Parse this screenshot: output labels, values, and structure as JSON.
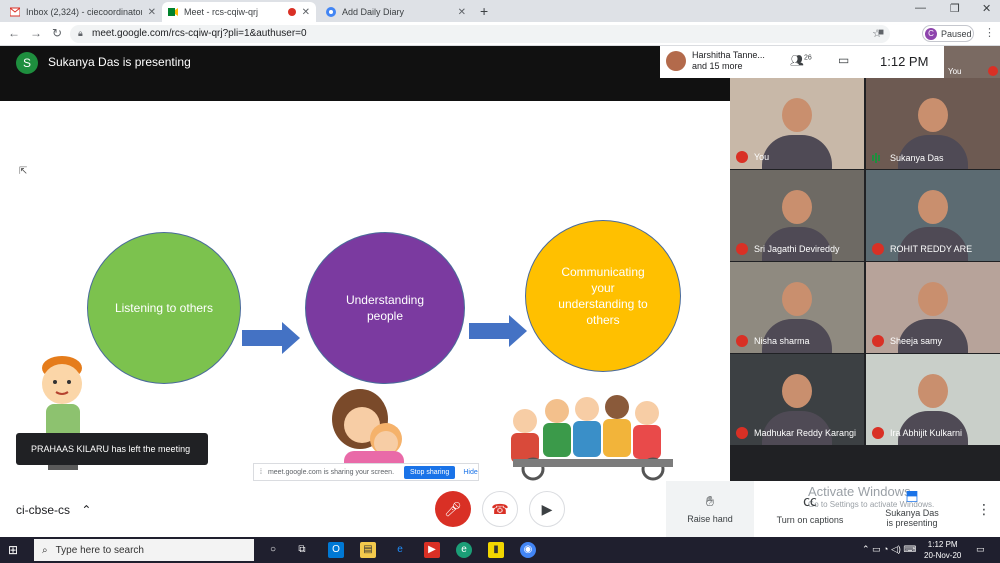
{
  "browser": {
    "tabs": [
      {
        "title": "Inbox (2,324) - ciecoordinator@",
        "icon": "gmail-icon"
      },
      {
        "title": "Meet - rcs-cqiw-qrj",
        "icon": "meet-icon",
        "active": true
      },
      {
        "title": "Add Daily Diary",
        "icon": "diary-icon"
      }
    ],
    "url": "meet.google.com/rcs-cqiw-qrj?pli=1&authuser=0",
    "profile_initial": "C",
    "profile_status": "Paused"
  },
  "meet": {
    "presenter_initial": "S",
    "presenter_text": "Sukanya Das is presenting",
    "top": {
      "attendees_label_1": "Harshitha Tanne...",
      "attendees_label_2": "and 15 more",
      "people_count": "26",
      "time": "1:12 PM",
      "self_label": "You"
    },
    "slide": {
      "circles": [
        {
          "text": "Listening to others",
          "color": "#7cc24e"
        },
        {
          "text": "Understanding people",
          "color": "#7b3aa0"
        },
        {
          "text": "Communicating your understanding to others",
          "color": "#ffc000"
        }
      ],
      "arrow_color": "#4472c4"
    },
    "participants": [
      {
        "name": "You",
        "muted": true,
        "bg": "#c8b8a8"
      },
      {
        "name": "Sukanya Das",
        "muted": false,
        "speaking": true,
        "bg": "#6d5a52"
      },
      {
        "name": "Sri Jagathi Devireddy",
        "muted": true,
        "bg": "#6e6a64"
      },
      {
        "name": "ROHIT REDDY ARE",
        "muted": true,
        "bg": "#5c6b72"
      },
      {
        "name": "Nisha sharma",
        "muted": true,
        "bg": "#8f8a80"
      },
      {
        "name": "Sheeja samy",
        "muted": true,
        "bg": "#b7a39a"
      },
      {
        "name": "Madhukar Reddy Karangi",
        "muted": true,
        "bg": "#3c4043"
      },
      {
        "name": "Ira Abhijit Kulkarni",
        "muted": true,
        "bg": "#c9cfc9"
      }
    ],
    "meeting_code": "ci-cbse-cs",
    "controls": {
      "raise_hand": "Raise hand",
      "captions": "Turn on captions",
      "presenting_line1": "Sukanya Das",
      "presenting_line2": "is presenting"
    },
    "toast": "PRAHAAS KILARU has left the meeting",
    "sharing_bar": {
      "text": "meet.google.com is sharing your screen.",
      "stop": "Stop sharing",
      "hide": "Hide"
    },
    "watermark_1": "Activate Windows",
    "watermark_2": "Go to Settings to activate Windows."
  },
  "taskbar": {
    "search_placeholder": "Type here to search",
    "time": "1:12 PM",
    "date": "20-Nov-20"
  }
}
